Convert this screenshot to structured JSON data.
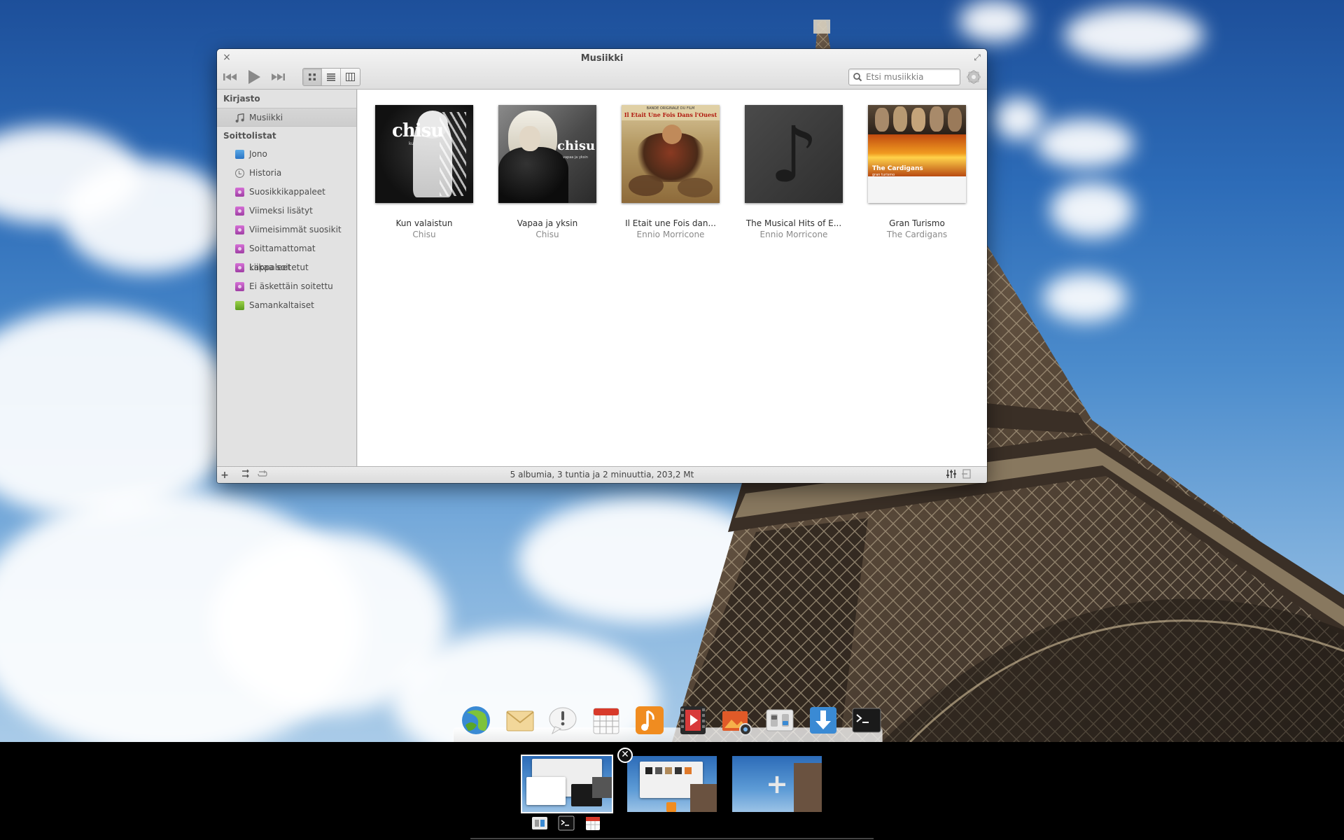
{
  "window": {
    "title": "Musiikki",
    "close_symbol": "×",
    "maximize_symbol": "⤢"
  },
  "toolbar": {
    "prev_icon": "skip-back-icon",
    "play_icon": "play-icon",
    "next_icon": "skip-forward-icon",
    "view_modes": [
      "grid-view-icon",
      "list-view-icon",
      "column-view-icon"
    ],
    "active_view": "grid-view-icon",
    "search_placeholder": "Etsi musiikkia",
    "settings_icon": "gear-icon"
  },
  "sidebar": {
    "library_header": "Kirjasto",
    "library_items": [
      {
        "label": "Musiikki",
        "icon": "music-note-icon",
        "selected": true
      }
    ],
    "playlists_header": "Soittolistat",
    "playlist_items": [
      {
        "label": "Jono",
        "icon": "queue-icon"
      },
      {
        "label": "Historia",
        "icon": "history-icon"
      },
      {
        "label": "Suosikkikappaleet",
        "icon": "smart-playlist-icon"
      },
      {
        "label": "Viimeksi lisätyt",
        "icon": "smart-playlist-icon"
      },
      {
        "label": "Viimeisimmät suosikit",
        "icon": "smart-playlist-icon"
      },
      {
        "label": "Soittamattomat kappaleet",
        "icon": "smart-playlist-icon"
      },
      {
        "label": "Liikaa soitetut",
        "icon": "smart-playlist-icon"
      },
      {
        "label": "Ei äskettäin soitettu",
        "icon": "smart-playlist-icon"
      },
      {
        "label": "Samankaltaiset",
        "icon": "similar-icon"
      }
    ]
  },
  "albums": [
    {
      "title": "Kun valaistun",
      "artist": "Chisu",
      "cover_text": "chisu",
      "cover_sub": "kun valaistun"
    },
    {
      "title": "Vapaa ja yksin",
      "artist": "Chisu",
      "cover_text": "chisu",
      "cover_sub": "vapaa ja yksin"
    },
    {
      "title": "Il Etait une Fois dan...",
      "artist": "Ennio Morricone",
      "cover_text": "Il Etait Une Fois Dans l'Ouest",
      "cover_sub": "BANDE ORIGINALE DU FILM"
    },
    {
      "title": "The Musical Hits of E...",
      "artist": "Ennio Morricone",
      "cover_text": "♪",
      "cover_sub": ""
    },
    {
      "title": "Gran Turismo",
      "artist": "The Cardigans",
      "cover_text": "The Cardigans",
      "cover_sub": "gran turismo"
    }
  ],
  "statusbar": {
    "add_symbol": "+",
    "shuffle_icon": "shuffle-icon",
    "repeat_icon": "repeat-icon",
    "summary": "5 albumia, 3 tuntia ja 2 minuuttia, 203,2 Mt",
    "equalizer_icon": "equalizer-icon",
    "info_panel_icon": "info-panel-icon"
  },
  "dock": {
    "apps": [
      "midori-browser-icon",
      "mail-icon",
      "notifications-icon",
      "calendar-icon",
      "music-icon",
      "videos-icon",
      "shotwell-icon",
      "switchboard-icon",
      "downloads-icon",
      "terminal-icon"
    ]
  },
  "workspaces": {
    "remove_symbol": "✕",
    "add_symbol": "+",
    "workspace_apps": [
      "switchboard-icon",
      "terminal-icon",
      "calendar-icon"
    ]
  },
  "colors": {
    "accent": "#2a74c4",
    "playlist": "#b04ab4",
    "similar": "#7ab83a",
    "music": "#f08c20"
  }
}
